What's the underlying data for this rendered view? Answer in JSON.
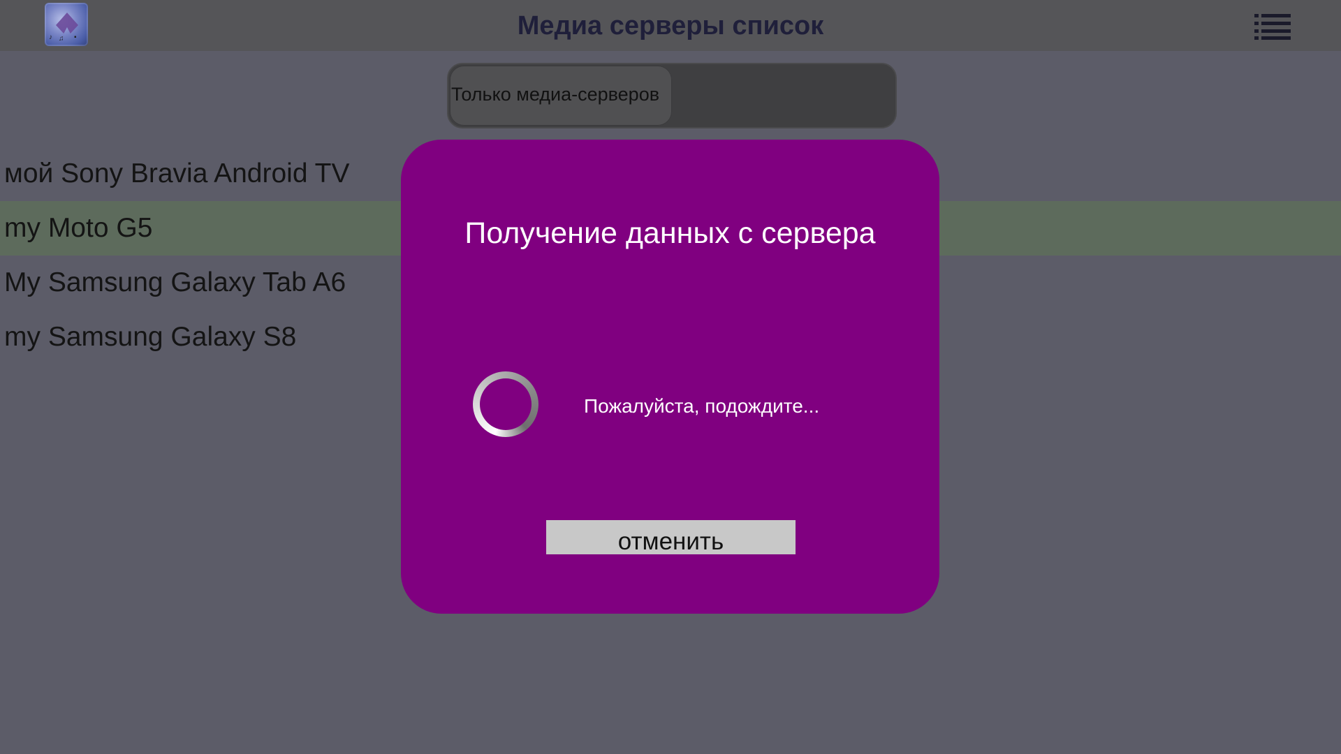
{
  "header": {
    "title": "Медиа серверы список",
    "logo_icon": "media-server-logo-icon",
    "menu_icon": "list-menu-icon"
  },
  "filter": {
    "label": "Только медиа-серверов",
    "state": "on"
  },
  "servers": [
    {
      "name": "мой Sony Bravia Android TV",
      "selected": false
    },
    {
      "name": "my Moto G5",
      "selected": true
    },
    {
      "name": "My Samsung Galaxy Tab A6",
      "selected": false
    },
    {
      "name": "my Samsung Galaxy S8",
      "selected": false
    }
  ],
  "dialog": {
    "title": "Получение данных с сервера",
    "message": "Пожалуйста, подождите...",
    "cancel_label": "отменить"
  },
  "colors": {
    "background": "#5c5c68",
    "header": "#555558",
    "dialog": "#800080",
    "selected_row": "#5d6b5c",
    "cancel_button": "#c8c8c8"
  }
}
